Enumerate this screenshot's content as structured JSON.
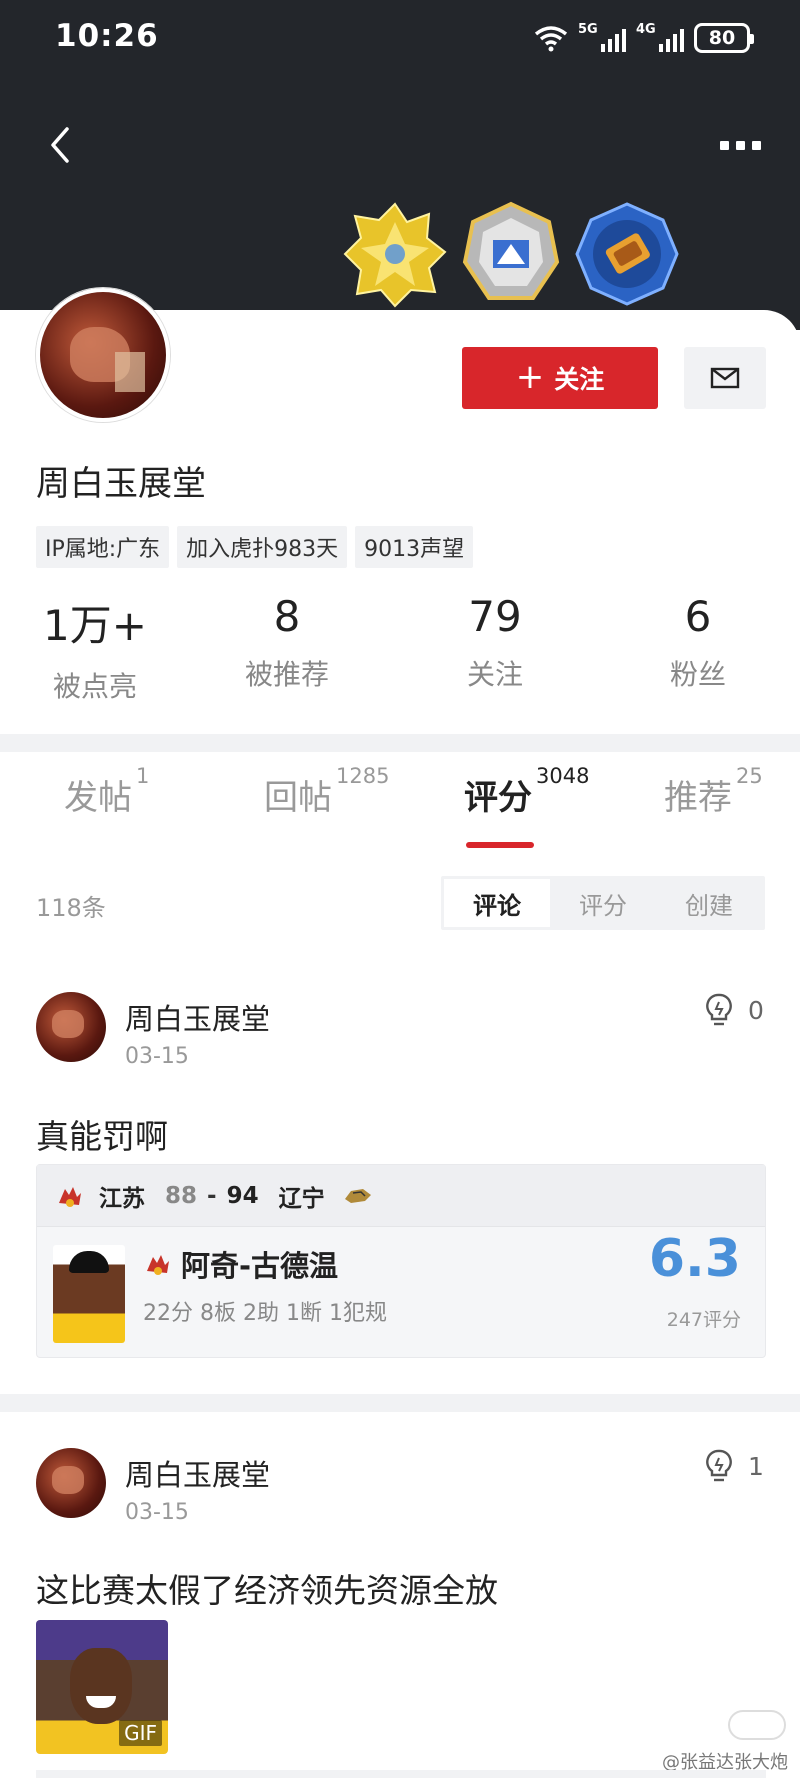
{
  "status_bar": {
    "time": "10:26",
    "network_1": "5G",
    "network_2": "4G",
    "battery": "80"
  },
  "header": {
    "back_icon": "chevron-left-icon",
    "more_icon": "more-dots-icon",
    "badges": [
      {
        "icon": "gold-star-badge-icon",
        "color": "#f2d23a"
      },
      {
        "icon": "silver-shield-badge-icon",
        "color": "#c9c9c9"
      },
      {
        "icon": "blue-ring-badge-icon",
        "color": "#2f6fd0"
      }
    ]
  },
  "profile": {
    "username": "周白玉展堂",
    "follow_label": "关注",
    "tags": [
      "IP属地:广东",
      "加入虎扑983天",
      "9013声望"
    ],
    "stats": [
      {
        "value": "1万+",
        "label": "被点亮"
      },
      {
        "value": "8",
        "label": "被推荐"
      },
      {
        "value": "79",
        "label": "关注"
      },
      {
        "value": "6",
        "label": "粉丝"
      }
    ]
  },
  "tabs": [
    {
      "label": "发帖",
      "count": "1"
    },
    {
      "label": "回帖",
      "count": "1285"
    },
    {
      "label": "评分",
      "count": "3048",
      "active": true
    },
    {
      "label": "推荐",
      "count": "25"
    }
  ],
  "list": {
    "count_text": "118条",
    "segments": [
      "评论",
      "评分",
      "创建"
    ],
    "active_segment": "评论"
  },
  "posts": [
    {
      "author": "周白玉展堂",
      "date": "03-15",
      "lights": "0",
      "text": "真能罚啊",
      "game": {
        "team1": "江苏",
        "score1": "88",
        "dash": "-",
        "score2": "94",
        "team2": "辽宁",
        "player": "阿奇-古德温",
        "player_stats": "22分 8板 2助 1断 1犯规",
        "rating": "6.3",
        "rating_count": "247评分"
      }
    },
    {
      "author": "周白玉展堂",
      "date": "03-15",
      "lights": "1",
      "text": "这比赛太假了经济领先资源全放",
      "gif_label": "GIF"
    }
  ],
  "colors": {
    "accent": "#d8262b",
    "header_bg": "#23262b",
    "rating": "#4a90d9"
  },
  "watermark": "@张益达张大炮"
}
